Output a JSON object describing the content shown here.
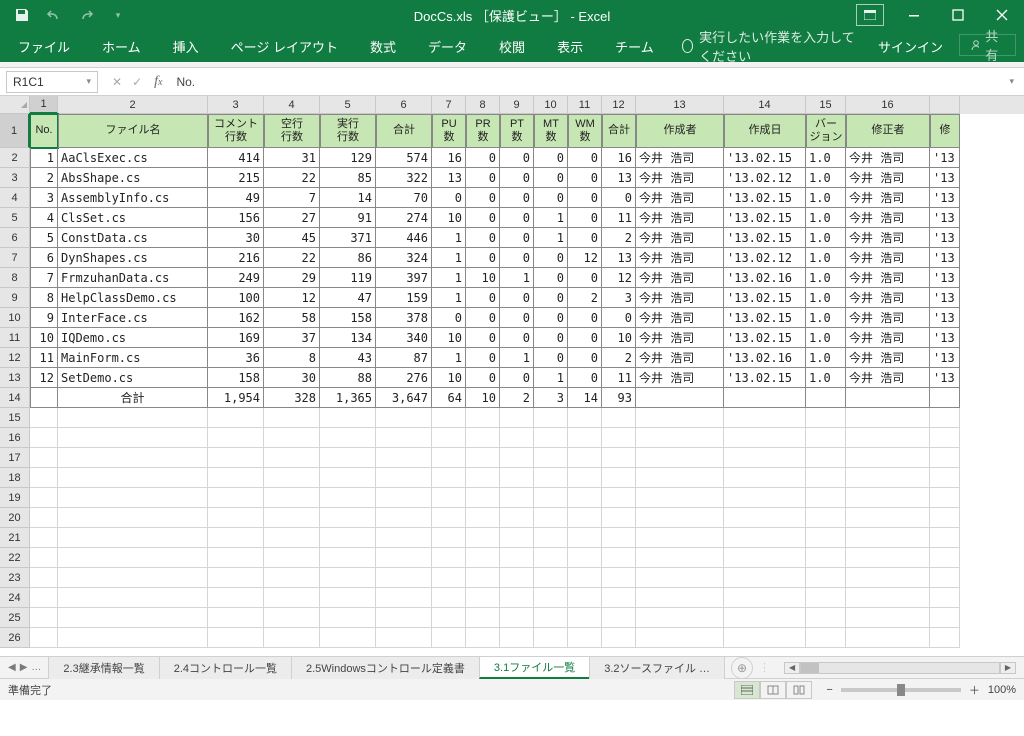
{
  "app": {
    "title": "DocCs.xls ［保護ビュー］ - Excel"
  },
  "ribbon": {
    "tabs": [
      "ファイル",
      "ホーム",
      "挿入",
      "ページ レイアウト",
      "数式",
      "データ",
      "校閲",
      "表示",
      "チーム"
    ],
    "tellme": "実行したい作業を入力してください",
    "signin": "サインイン",
    "share": "共有"
  },
  "formula": {
    "cellref": "R1C1",
    "value": "No."
  },
  "grid": {
    "col_labels_top": [
      "1",
      "2",
      "3",
      "4",
      "5",
      "6",
      "7",
      "8",
      "9",
      "10",
      "11",
      "12",
      "13",
      "14",
      "15",
      "16",
      ""
    ],
    "headers": [
      "No.",
      "ファイル名",
      "コメント\n行数",
      "空行\n行数",
      "実行\n行数",
      "合計",
      "PU\n数",
      "PR\n数",
      "PT\n数",
      "MT\n数",
      "WM\n数",
      "合計",
      "作成者",
      "作成日",
      "バー\nジョン",
      "修正者",
      "修"
    ],
    "rows": [
      {
        "no": "1",
        "file": "AaClsExec.cs",
        "c": "414",
        "b": "31",
        "e": "129",
        "sum": "574",
        "pu": "16",
        "pr": "0",
        "pt": "0",
        "mt": "0",
        "wm": "0",
        "s2": "16",
        "auth": "今井 浩司",
        "date": "'13.02.15",
        "ver": "1.0",
        "mod": "今井 浩司",
        "last": "'13"
      },
      {
        "no": "2",
        "file": "AbsShape.cs",
        "c": "215",
        "b": "22",
        "e": "85",
        "sum": "322",
        "pu": "13",
        "pr": "0",
        "pt": "0",
        "mt": "0",
        "wm": "0",
        "s2": "13",
        "auth": "今井 浩司",
        "date": "'13.02.12",
        "ver": "1.0",
        "mod": "今井 浩司",
        "last": "'13"
      },
      {
        "no": "3",
        "file": "AssemblyInfo.cs",
        "c": "49",
        "b": "7",
        "e": "14",
        "sum": "70",
        "pu": "0",
        "pr": "0",
        "pt": "0",
        "mt": "0",
        "wm": "0",
        "s2": "0",
        "auth": "今井 浩司",
        "date": "'13.02.15",
        "ver": "1.0",
        "mod": "今井 浩司",
        "last": "'13"
      },
      {
        "no": "4",
        "file": "ClsSet.cs",
        "c": "156",
        "b": "27",
        "e": "91",
        "sum": "274",
        "pu": "10",
        "pr": "0",
        "pt": "0",
        "mt": "1",
        "wm": "0",
        "s2": "11",
        "auth": "今井 浩司",
        "date": "'13.02.15",
        "ver": "1.0",
        "mod": "今井 浩司",
        "last": "'13"
      },
      {
        "no": "5",
        "file": "ConstData.cs",
        "c": "30",
        "b": "45",
        "e": "371",
        "sum": "446",
        "pu": "1",
        "pr": "0",
        "pt": "0",
        "mt": "1",
        "wm": "0",
        "s2": "2",
        "auth": "今井 浩司",
        "date": "'13.02.15",
        "ver": "1.0",
        "mod": "今井 浩司",
        "last": "'13"
      },
      {
        "no": "6",
        "file": "DynShapes.cs",
        "c": "216",
        "b": "22",
        "e": "86",
        "sum": "324",
        "pu": "1",
        "pr": "0",
        "pt": "0",
        "mt": "0",
        "wm": "12",
        "s2": "13",
        "auth": "今井 浩司",
        "date": "'13.02.12",
        "ver": "1.0",
        "mod": "今井 浩司",
        "last": "'13"
      },
      {
        "no": "7",
        "file": "FrmzuhanData.cs",
        "c": "249",
        "b": "29",
        "e": "119",
        "sum": "397",
        "pu": "1",
        "pr": "10",
        "pt": "1",
        "mt": "0",
        "wm": "0",
        "s2": "12",
        "auth": "今井 浩司",
        "date": "'13.02.16",
        "ver": "1.0",
        "mod": "今井 浩司",
        "last": "'13"
      },
      {
        "no": "8",
        "file": "HelpClassDemo.cs",
        "c": "100",
        "b": "12",
        "e": "47",
        "sum": "159",
        "pu": "1",
        "pr": "0",
        "pt": "0",
        "mt": "0",
        "wm": "2",
        "s2": "3",
        "auth": "今井 浩司",
        "date": "'13.02.15",
        "ver": "1.0",
        "mod": "今井 浩司",
        "last": "'13"
      },
      {
        "no": "9",
        "file": "InterFace.cs",
        "c": "162",
        "b": "58",
        "e": "158",
        "sum": "378",
        "pu": "0",
        "pr": "0",
        "pt": "0",
        "mt": "0",
        "wm": "0",
        "s2": "0",
        "auth": "今井 浩司",
        "date": "'13.02.15",
        "ver": "1.0",
        "mod": "今井 浩司",
        "last": "'13"
      },
      {
        "no": "10",
        "file": "IQDemo.cs",
        "c": "169",
        "b": "37",
        "e": "134",
        "sum": "340",
        "pu": "10",
        "pr": "0",
        "pt": "0",
        "mt": "0",
        "wm": "0",
        "s2": "10",
        "auth": "今井 浩司",
        "date": "'13.02.15",
        "ver": "1.0",
        "mod": "今井 浩司",
        "last": "'13"
      },
      {
        "no": "11",
        "file": "MainForm.cs",
        "c": "36",
        "b": "8",
        "e": "43",
        "sum": "87",
        "pu": "1",
        "pr": "0",
        "pt": "1",
        "mt": "0",
        "wm": "0",
        "s2": "2",
        "auth": "今井 浩司",
        "date": "'13.02.16",
        "ver": "1.0",
        "mod": "今井 浩司",
        "last": "'13"
      },
      {
        "no": "12",
        "file": "SetDemo.cs",
        "c": "158",
        "b": "30",
        "e": "88",
        "sum": "276",
        "pu": "10",
        "pr": "0",
        "pt": "0",
        "mt": "1",
        "wm": "0",
        "s2": "11",
        "auth": "今井 浩司",
        "date": "'13.02.15",
        "ver": "1.0",
        "mod": "今井 浩司",
        "last": "'13"
      }
    ],
    "total": {
      "file": "合計",
      "c": "1,954",
      "b": "328",
      "e": "1,365",
      "sum": "3,647",
      "pu": "64",
      "pr": "10",
      "pt": "2",
      "mt": "3",
      "wm": "14",
      "s2": "93"
    }
  },
  "sheets": {
    "nav_ellipsis": "…",
    "tabs": [
      "2.3継承情報一覧",
      "2.4コントロール一覧",
      "2.5Windowsコントロール定義書",
      "3.1ファイル一覧",
      "3.2ソースファイル  …"
    ],
    "active_index": 3
  },
  "status": {
    "ready": "準備完了",
    "zoom": "100%"
  }
}
